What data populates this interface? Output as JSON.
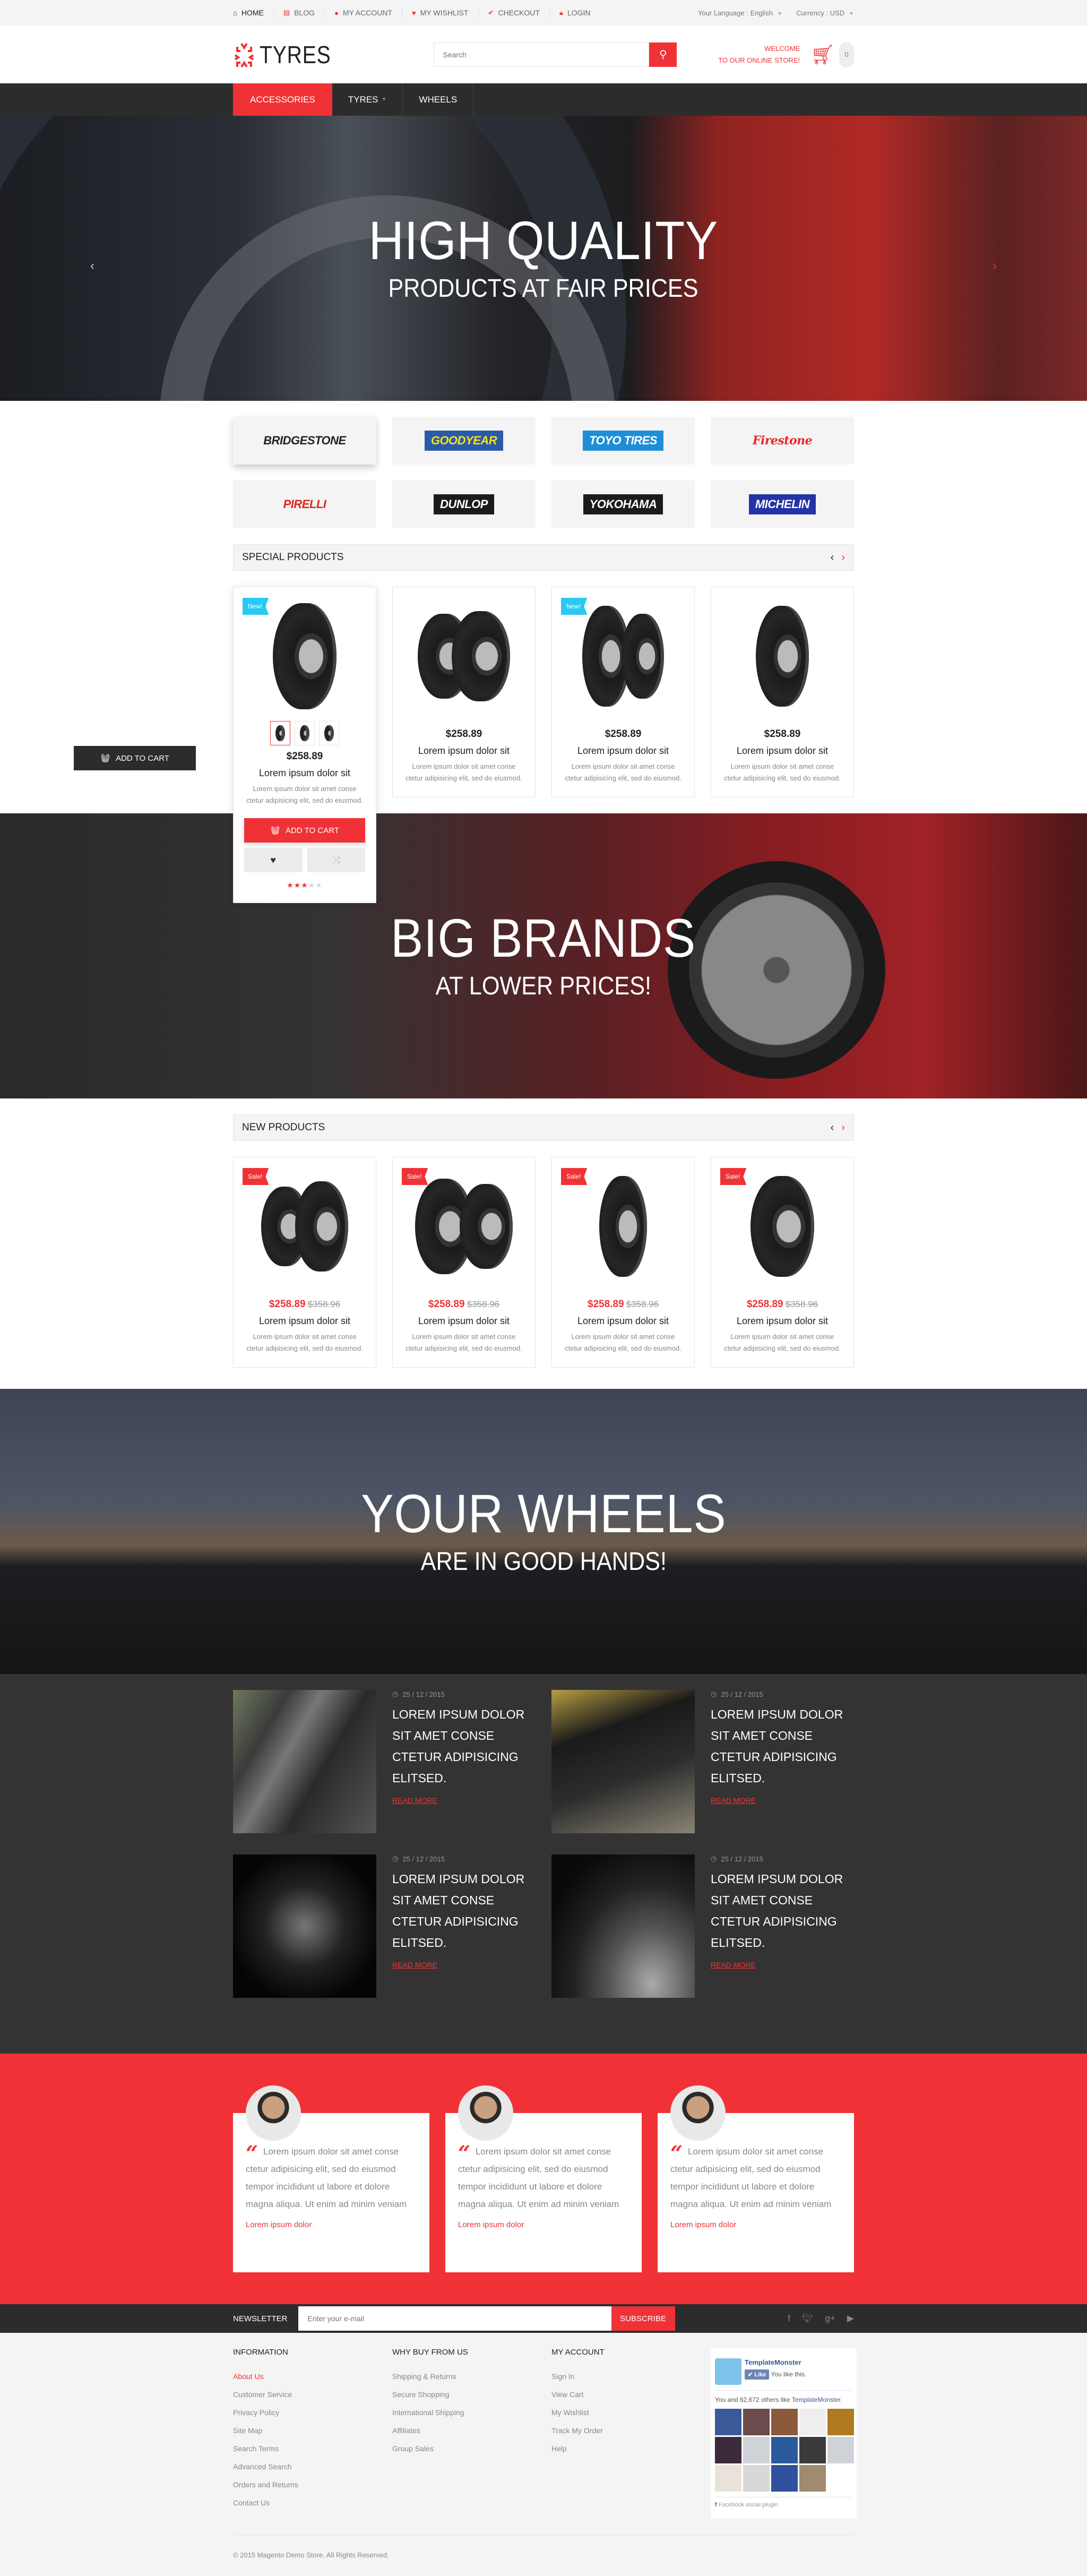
{
  "topbar": {
    "links": [
      {
        "label": "Home",
        "icon": "home-icon"
      },
      {
        "label": "Blog",
        "icon": "blog-icon"
      },
      {
        "label": "My Account",
        "icon": "user-icon"
      },
      {
        "label": "My Wishlist",
        "icon": "heart-icon"
      },
      {
        "label": "Checkout",
        "icon": "check-icon"
      },
      {
        "label": "Login",
        "icon": "lock-icon"
      }
    ],
    "language": "Your Language : English",
    "currency": "Currency : USD"
  },
  "header": {
    "logo_text": "TYRES",
    "search_placeholder": "Search",
    "welcome_line1": "Welcome",
    "welcome_line2": "to our online store!",
    "cart_count": "0"
  },
  "nav": {
    "items": [
      {
        "label": "Accessories",
        "active": true
      },
      {
        "label": "Tyres",
        "has_dropdown": true
      },
      {
        "label": "Wheels"
      }
    ]
  },
  "hero1": {
    "title": "HIGH QUALITY",
    "subtitle": "PRODUCTS AT FAIR PRICES"
  },
  "brands": [
    "Bridgestone",
    "Goodyear",
    "Toyo Tires",
    "Firestone",
    "Pirelli",
    "Dunlop",
    "Yokohama",
    "Michelin"
  ],
  "brand_colors": {
    "Bridgestone": {
      "bg": "transparent",
      "fg": "#222222"
    },
    "Goodyear": {
      "bg": "#2a5aa8",
      "fg": "#f5e31a"
    },
    "Toyo Tires": {
      "bg": "#1e8fd6",
      "fg": "#ffffff"
    },
    "Firestone": {
      "bg": "transparent",
      "fg": "#e8282b"
    },
    "Pirelli": {
      "bg": "transparent",
      "fg": "#e0281c"
    },
    "Dunlop": {
      "bg": "#1b1b1b",
      "fg": "#ffffff"
    },
    "Yokohama": {
      "bg": "#1b1b1b",
      "fg": "#ffffff"
    },
    "Michelin": {
      "bg": "#2433a8",
      "fg": "#ffffff"
    }
  },
  "special": {
    "title": "Special Products",
    "floating_add_to_cart": "Add to cart",
    "products": [
      {
        "badge": "New!",
        "price": "$258.89",
        "name": "Lorem ipsum dolor sit",
        "desc": "Lorem ipsum dolor sit amet conse ctetur adipisicing elit, sed do eiusmod.",
        "add_to_cart": "Add to cart",
        "rating": 3,
        "rating_max": 5
      },
      {
        "badge": "",
        "price": "$258.89",
        "name": "Lorem ipsum dolor sit",
        "desc": "Lorem ipsum dolor sit amet conse ctetur adipisicing elit, sed do eiusmod."
      },
      {
        "badge": "New!",
        "price": "$258.89",
        "name": "Lorem ipsum dolor sit",
        "desc": "Lorem ipsum dolor sit amet conse ctetur adipisicing elit, sed do eiusmod."
      },
      {
        "badge": "",
        "price": "$258.89",
        "name": "Lorem ipsum dolor sit",
        "desc": "Lorem ipsum dolor sit amet conse ctetur adipisicing elit, sed do eiusmod."
      }
    ]
  },
  "hero2": {
    "title": "BIG BRANDS",
    "subtitle": "AT LOWER PRICES!"
  },
  "newproducts": {
    "title": "New Products",
    "products": [
      {
        "badge": "Sale!",
        "price": "$258.89",
        "old_price": "$358.96",
        "name": "Lorem ipsum dolor sit",
        "desc": "Lorem ipsum dolor sit amet conse ctetur adipisicing elit, sed do eiusmod."
      },
      {
        "badge": "Sale!",
        "price": "$258.89",
        "old_price": "$358.96",
        "name": "Lorem ipsum dolor sit",
        "desc": "Lorem ipsum dolor sit amet conse ctetur adipisicing elit, sed do eiusmod."
      },
      {
        "badge": "Sale!",
        "price": "$258.89",
        "old_price": "$358.96",
        "name": "Lorem ipsum dolor sit",
        "desc": "Lorem ipsum dolor sit amet conse ctetur adipisicing elit, sed do eiusmod."
      },
      {
        "badge": "Sale!",
        "price": "$258.89",
        "old_price": "$358.96",
        "name": "Lorem ipsum dolor sit",
        "desc": "Lorem ipsum dolor sit amet conse ctetur adipisicing elit, sed do eiusmod."
      }
    ]
  },
  "hero3": {
    "title": "YOUR WHEELS",
    "subtitle": "ARE IN GOOD HANDS!"
  },
  "blog": {
    "posts": [
      {
        "date": "25 / 12 / 2015",
        "title": "Lorem ipsum dolor sit amet conse ctetur adipisicing elitsed.",
        "more": "Read more"
      },
      {
        "date": "25 / 12 / 2015",
        "title": "Lorem ipsum dolor sit amet conse ctetur adipisicing elitsed.",
        "more": "Read more"
      },
      {
        "date": "25 / 12 / 2015",
        "title": "Lorem ipsum dolor sit amet conse ctetur adipisicing elitsed.",
        "more": "Read more"
      },
      {
        "date": "25 / 12 / 2015",
        "title": "Lorem ipsum dolor sit amet conse ctetur adipisicing elitsed.",
        "more": "Read more"
      }
    ]
  },
  "testimonials": [
    {
      "quote": "Lorem ipsum dolor sit amet conse ctetur adipisicing elit, sed do eiusmod tempor incididunt ut labore et dolore magna aliqua. Ut enim ad minim veniam",
      "author": "Lorem ipsum dolor"
    },
    {
      "quote": "Lorem ipsum dolor sit amet conse ctetur adipisicing elit, sed do eiusmod tempor incididunt ut labore et dolore magna aliqua. Ut enim ad minim veniam",
      "author": "Lorem ipsum dolor"
    },
    {
      "quote": "Lorem ipsum dolor sit amet conse ctetur adipisicing elit, sed do eiusmod tempor incididunt ut labore et dolore magna aliqua. Ut enim ad minim veniam",
      "author": "Lorem ipsum dolor"
    }
  ],
  "newsletter": {
    "label": "Newsletter",
    "placeholder": "Enter your e-mail",
    "button": "Subscribe",
    "social": [
      "facebook-icon",
      "twitter-icon",
      "google-plus-icon",
      "youtube-icon"
    ]
  },
  "footer": {
    "columns": [
      {
        "title": "Information",
        "links": [
          "About Us",
          "Customer Service",
          "Privacy Policy",
          "Site Map",
          "Search Terms",
          "Advanced Search",
          "Orders and Returns",
          "Contact Us"
        ],
        "active": 0
      },
      {
        "title": "Why buy from us",
        "links": [
          "Shipping & Returns",
          "Secure Shopping",
          "International Shipping",
          "Affiliates",
          "Group Sales"
        ]
      },
      {
        "title": "My Account",
        "links": [
          "Sign In",
          "View Cart",
          "My Wishlist",
          "Track My Order",
          "Help"
        ]
      }
    ],
    "facebook": {
      "page_name": "TemplateMonster",
      "like_label": "Like",
      "you_like": "You like this.",
      "count_prefix": "You and 62,672 others like",
      "count_page": "TemplateMonster",
      "plugin_label": "Facebook social plugin"
    },
    "copyright": "© 2015 Magento Demo Store. All Rights Reserved."
  },
  "accent_color": "#f03236"
}
